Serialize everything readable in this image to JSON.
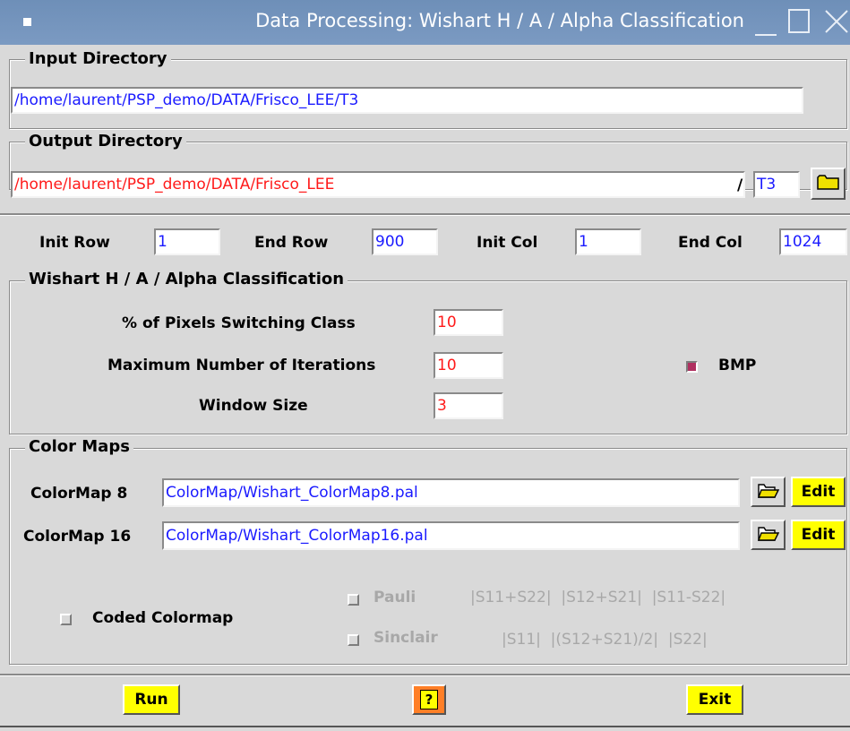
{
  "window": {
    "title": "Data Processing: Wishart H / A / Alpha Classification"
  },
  "input_dir": {
    "legend": "Input Directory",
    "value": "/home/laurent/PSP_demo/DATA/Frisco_LEE/T3"
  },
  "output_dir": {
    "legend": "Output Directory",
    "value": "/home/laurent/PSP_demo/DATA/Frisco_LEE",
    "separator": "/",
    "subdir": "T3"
  },
  "range": {
    "init_row_label": "Init Row",
    "init_row": "1",
    "end_row_label": "End Row",
    "end_row": "900",
    "init_col_label": "Init Col",
    "init_col": "1",
    "end_col_label": "End Col",
    "end_col": "1024"
  },
  "wishart": {
    "legend": "Wishart H / A / Alpha Classification",
    "pct_label": "% of Pixels Switching Class",
    "pct_value": "10",
    "iter_label": "Maximum Number of Iterations",
    "iter_value": "10",
    "window_label": "Window Size",
    "window_value": "3",
    "bmp_label": "BMP",
    "bmp_checked": true
  },
  "colormaps": {
    "legend": "Color Maps",
    "cm8_label": "ColorMap 8",
    "cm8_value": "ColorMap/Wishart_ColorMap8.pal",
    "cm16_label": "ColorMap 16",
    "cm16_value": "ColorMap/Wishart_ColorMap16.pal",
    "edit_label": "Edit",
    "coded_label": "Coded Colormap",
    "pauli_label": "Pauli",
    "pauli_formula": "|S11+S22|  |S12+S21|  |S11-S22|",
    "sinclair_label": "Sinclair",
    "sinclair_formula": "|S11|  |(S12+S21)/2|  |S22|"
  },
  "footer": {
    "run_label": "Run",
    "help_label": "?",
    "exit_label": "Exit"
  },
  "colors": {
    "title_bar": "#7b9ac2",
    "input_text": "#1a1aff",
    "output_text": "#ff1a1a",
    "button_yellow": "#ffff00",
    "help_orange": "#ff7f27",
    "checked_box": "#b03060"
  }
}
